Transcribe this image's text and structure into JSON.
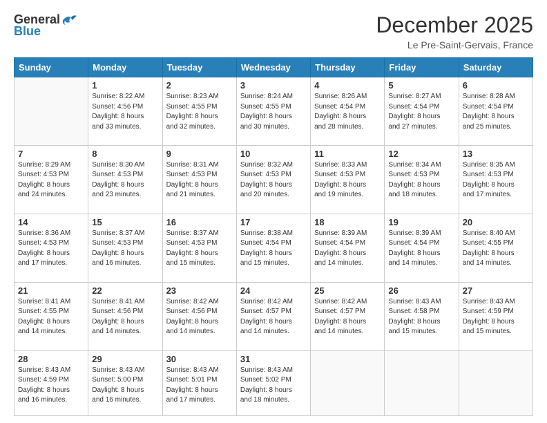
{
  "header": {
    "logo_general": "General",
    "logo_blue": "Blue",
    "month_title": "December 2025",
    "location": "Le Pre-Saint-Gervais, France"
  },
  "days_of_week": [
    "Sunday",
    "Monday",
    "Tuesday",
    "Wednesday",
    "Thursday",
    "Friday",
    "Saturday"
  ],
  "weeks": [
    [
      {
        "day": "",
        "info": ""
      },
      {
        "day": "1",
        "info": "Sunrise: 8:22 AM\nSunset: 4:56 PM\nDaylight: 8 hours\nand 33 minutes."
      },
      {
        "day": "2",
        "info": "Sunrise: 8:23 AM\nSunset: 4:55 PM\nDaylight: 8 hours\nand 32 minutes."
      },
      {
        "day": "3",
        "info": "Sunrise: 8:24 AM\nSunset: 4:55 PM\nDaylight: 8 hours\nand 30 minutes."
      },
      {
        "day": "4",
        "info": "Sunrise: 8:26 AM\nSunset: 4:54 PM\nDaylight: 8 hours\nand 28 minutes."
      },
      {
        "day": "5",
        "info": "Sunrise: 8:27 AM\nSunset: 4:54 PM\nDaylight: 8 hours\nand 27 minutes."
      },
      {
        "day": "6",
        "info": "Sunrise: 8:28 AM\nSunset: 4:54 PM\nDaylight: 8 hours\nand 25 minutes."
      }
    ],
    [
      {
        "day": "7",
        "info": "Sunrise: 8:29 AM\nSunset: 4:53 PM\nDaylight: 8 hours\nand 24 minutes."
      },
      {
        "day": "8",
        "info": "Sunrise: 8:30 AM\nSunset: 4:53 PM\nDaylight: 8 hours\nand 23 minutes."
      },
      {
        "day": "9",
        "info": "Sunrise: 8:31 AM\nSunset: 4:53 PM\nDaylight: 8 hours\nand 21 minutes."
      },
      {
        "day": "10",
        "info": "Sunrise: 8:32 AM\nSunset: 4:53 PM\nDaylight: 8 hours\nand 20 minutes."
      },
      {
        "day": "11",
        "info": "Sunrise: 8:33 AM\nSunset: 4:53 PM\nDaylight: 8 hours\nand 19 minutes."
      },
      {
        "day": "12",
        "info": "Sunrise: 8:34 AM\nSunset: 4:53 PM\nDaylight: 8 hours\nand 18 minutes."
      },
      {
        "day": "13",
        "info": "Sunrise: 8:35 AM\nSunset: 4:53 PM\nDaylight: 8 hours\nand 17 minutes."
      }
    ],
    [
      {
        "day": "14",
        "info": "Sunrise: 8:36 AM\nSunset: 4:53 PM\nDaylight: 8 hours\nand 17 minutes."
      },
      {
        "day": "15",
        "info": "Sunrise: 8:37 AM\nSunset: 4:53 PM\nDaylight: 8 hours\nand 16 minutes."
      },
      {
        "day": "16",
        "info": "Sunrise: 8:37 AM\nSunset: 4:53 PM\nDaylight: 8 hours\nand 15 minutes."
      },
      {
        "day": "17",
        "info": "Sunrise: 8:38 AM\nSunset: 4:54 PM\nDaylight: 8 hours\nand 15 minutes."
      },
      {
        "day": "18",
        "info": "Sunrise: 8:39 AM\nSunset: 4:54 PM\nDaylight: 8 hours\nand 14 minutes."
      },
      {
        "day": "19",
        "info": "Sunrise: 8:39 AM\nSunset: 4:54 PM\nDaylight: 8 hours\nand 14 minutes."
      },
      {
        "day": "20",
        "info": "Sunrise: 8:40 AM\nSunset: 4:55 PM\nDaylight: 8 hours\nand 14 minutes."
      }
    ],
    [
      {
        "day": "21",
        "info": "Sunrise: 8:41 AM\nSunset: 4:55 PM\nDaylight: 8 hours\nand 14 minutes."
      },
      {
        "day": "22",
        "info": "Sunrise: 8:41 AM\nSunset: 4:56 PM\nDaylight: 8 hours\nand 14 minutes."
      },
      {
        "day": "23",
        "info": "Sunrise: 8:42 AM\nSunset: 4:56 PM\nDaylight: 8 hours\nand 14 minutes."
      },
      {
        "day": "24",
        "info": "Sunrise: 8:42 AM\nSunset: 4:57 PM\nDaylight: 8 hours\nand 14 minutes."
      },
      {
        "day": "25",
        "info": "Sunrise: 8:42 AM\nSunset: 4:57 PM\nDaylight: 8 hours\nand 14 minutes."
      },
      {
        "day": "26",
        "info": "Sunrise: 8:43 AM\nSunset: 4:58 PM\nDaylight: 8 hours\nand 15 minutes."
      },
      {
        "day": "27",
        "info": "Sunrise: 8:43 AM\nSunset: 4:59 PM\nDaylight: 8 hours\nand 15 minutes."
      }
    ],
    [
      {
        "day": "28",
        "info": "Sunrise: 8:43 AM\nSunset: 4:59 PM\nDaylight: 8 hours\nand 16 minutes."
      },
      {
        "day": "29",
        "info": "Sunrise: 8:43 AM\nSunset: 5:00 PM\nDaylight: 8 hours\nand 16 minutes."
      },
      {
        "day": "30",
        "info": "Sunrise: 8:43 AM\nSunset: 5:01 PM\nDaylight: 8 hours\nand 17 minutes."
      },
      {
        "day": "31",
        "info": "Sunrise: 8:43 AM\nSunset: 5:02 PM\nDaylight: 8 hours\nand 18 minutes."
      },
      {
        "day": "",
        "info": ""
      },
      {
        "day": "",
        "info": ""
      },
      {
        "day": "",
        "info": ""
      }
    ]
  ]
}
